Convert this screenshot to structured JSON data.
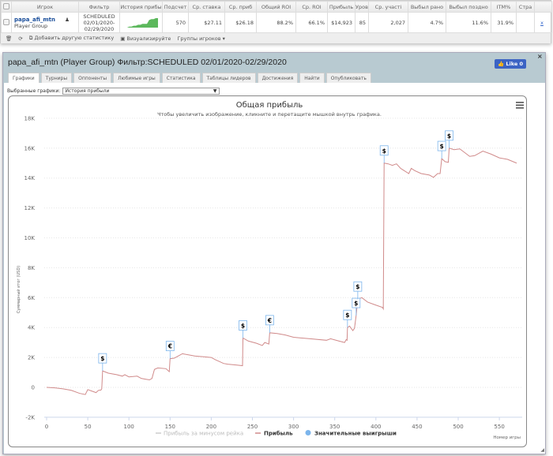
{
  "table": {
    "headers": [
      "Игрок",
      "Фильтр",
      "История прибы",
      "Подсчет",
      "Ср. ставка",
      "Ср. приб",
      "Общий ROI",
      "Ср. ROI",
      "Прибыль",
      "Уровен",
      "Ср. участі",
      "Выбыл рано",
      "Выбыл поздно",
      "ITM%",
      "Стра"
    ],
    "row": {
      "player": "papa_afi_mtn",
      "group": "Player Group",
      "filter": [
        "SCHEDULED",
        "02/01/2020-",
        "02/29/2020"
      ],
      "count": "570",
      "avg_stake": "$27.11",
      "avg_profit": "$26.18",
      "total_roi": "88.2%",
      "avg_roi": "66.1%",
      "profit": "$14,923",
      "level": "85",
      "avg_entrants": "2,027",
      "early_out": "4.7%",
      "late_out": "11.6%",
      "itm": "31.9%",
      "country": "",
      "remove": "x"
    },
    "sparkline": [
      0,
      0,
      1,
      1,
      2,
      2,
      3,
      3,
      4,
      4,
      4,
      8,
      9,
      9,
      10,
      10
    ]
  },
  "toolbar": {
    "add_stat": "Добавить другую статистику",
    "visualize": "Визуализируйте",
    "groups": "Группы игроков ▾"
  },
  "panel": {
    "title": "papa_afi_mtn (Player Group) Фильтр:SCHEDULED 02/01/2020-02/29/2020",
    "like": "Like 0",
    "close": "×",
    "tabs": [
      "Графики",
      "Турниры",
      "Оппоненты",
      "Любимые игры",
      "Статистика",
      "Таблицы лидеров",
      "Достижения",
      "Найти",
      "Опубликовать"
    ],
    "select_label": "Выбранные графики:",
    "select_value": "История прибыли"
  },
  "chart_data": {
    "type": "line",
    "title": "Общая прибыль",
    "subtitle": "Чтобы увеличить изображение, кликните и перетащите мышкой внутрь графика.",
    "xlabel": "Номер игры",
    "ylabel": "Суммарный итог (USD)",
    "xlim": [
      0,
      572
    ],
    "ylim": [
      -2000,
      18000
    ],
    "xticks": [
      0,
      50,
      100,
      150,
      200,
      250,
      300,
      350,
      400,
      450,
      500,
      550
    ],
    "yticks": [
      {
        "v": -2000,
        "l": "-2K"
      },
      {
        "v": 0,
        "l": "0"
      },
      {
        "v": 2000,
        "l": "2K"
      },
      {
        "v": 4000,
        "l": "4K"
      },
      {
        "v": 6000,
        "l": "6K"
      },
      {
        "v": 8000,
        "l": "8K"
      },
      {
        "v": 10000,
        "l": "10K"
      },
      {
        "v": 12000,
        "l": "12K"
      },
      {
        "v": 14000,
        "l": "14K"
      },
      {
        "v": 16000,
        "l": "16K"
      },
      {
        "v": 18000,
        "l": "18K"
      }
    ],
    "legend": [
      "Прибыль за минусом рейка",
      "Прибыль",
      "Значительные выигрыши"
    ],
    "colors": {
      "profit": "#d08a8a",
      "rake": "#ccc",
      "marker": "#7cb5ec"
    },
    "series": [
      {
        "name": "Прибыль",
        "points": [
          [
            0,
            0
          ],
          [
            10,
            -30
          ],
          [
            20,
            -100
          ],
          [
            30,
            -200
          ],
          [
            40,
            -400
          ],
          [
            47,
            -480
          ],
          [
            50,
            -150
          ],
          [
            55,
            -250
          ],
          [
            60,
            -350
          ],
          [
            63,
            -200
          ],
          [
            66,
            -180
          ],
          [
            67,
            -100
          ],
          [
            68,
            1100
          ],
          [
            75,
            950
          ],
          [
            85,
            850
          ],
          [
            92,
            750
          ],
          [
            95,
            850
          ],
          [
            100,
            700
          ],
          [
            110,
            750
          ],
          [
            115,
            600
          ],
          [
            120,
            550
          ],
          [
            125,
            500
          ],
          [
            128,
            600
          ],
          [
            131,
            1200
          ],
          [
            135,
            1300
          ],
          [
            145,
            1250
          ],
          [
            149,
            1050
          ],
          [
            150,
            1920
          ],
          [
            155,
            1950
          ],
          [
            160,
            2100
          ],
          [
            165,
            2250
          ],
          [
            180,
            2100
          ],
          [
            190,
            2050
          ],
          [
            200,
            2000
          ],
          [
            205,
            1850
          ],
          [
            215,
            1600
          ],
          [
            220,
            1550
          ],
          [
            230,
            1500
          ],
          [
            238,
            1450
          ],
          [
            238.5,
            3300
          ],
          [
            245,
            3100
          ],
          [
            255,
            2950
          ],
          [
            262,
            2800
          ],
          [
            265,
            3000
          ],
          [
            270,
            2900
          ],
          [
            271,
            3650
          ],
          [
            280,
            3600
          ],
          [
            290,
            3500
          ],
          [
            300,
            3350
          ],
          [
            320,
            3250
          ],
          [
            340,
            3150
          ],
          [
            345,
            3250
          ],
          [
            355,
            3100
          ],
          [
            362,
            3000
          ],
          [
            364,
            3200
          ],
          [
            365,
            3150
          ],
          [
            365.5,
            4000
          ],
          [
            368,
            4100
          ],
          [
            372,
            3800
          ],
          [
            374,
            3950
          ],
          [
            376,
            4800
          ],
          [
            378,
            5900
          ],
          [
            383,
            6000
          ],
          [
            390,
            5700
          ],
          [
            400,
            5500
          ],
          [
            408,
            5350
          ],
          [
            409,
            5250
          ],
          [
            410,
            15000
          ],
          [
            415,
            14950
          ],
          [
            420,
            14850
          ],
          [
            425,
            14950
          ],
          [
            430,
            14650
          ],
          [
            440,
            14300
          ],
          [
            443,
            14650
          ],
          [
            447,
            14500
          ],
          [
            455,
            14300
          ],
          [
            465,
            14200
          ],
          [
            470,
            14050
          ],
          [
            475,
            14300
          ],
          [
            478,
            14300
          ],
          [
            480,
            15300
          ],
          [
            484,
            15100
          ],
          [
            488,
            15050
          ],
          [
            489,
            16000
          ],
          [
            495,
            15900
          ],
          [
            502,
            15950
          ],
          [
            508,
            15700
          ],
          [
            514,
            15450
          ],
          [
            520,
            15500
          ],
          [
            530,
            15800
          ],
          [
            540,
            15600
          ],
          [
            550,
            15350
          ],
          [
            560,
            15250
          ],
          [
            571,
            15000
          ]
        ]
      }
    ],
    "big_wins": [
      {
        "x": 68,
        "y": 1100,
        "s": "$"
      },
      {
        "x": 150,
        "y": 1920,
        "s": "€"
      },
      {
        "x": 238.5,
        "y": 3300,
        "s": "$"
      },
      {
        "x": 271,
        "y": 3650,
        "s": "€"
      },
      {
        "x": 365.5,
        "y": 4000,
        "s": "$"
      },
      {
        "x": 376,
        "y": 4800,
        "s": "$"
      },
      {
        "x": 378,
        "y": 5900,
        "s": "$"
      },
      {
        "x": 410,
        "y": 15000,
        "s": "$"
      },
      {
        "x": 480,
        "y": 15300,
        "s": "$"
      },
      {
        "x": 489,
        "y": 16000,
        "s": "$"
      }
    ]
  }
}
